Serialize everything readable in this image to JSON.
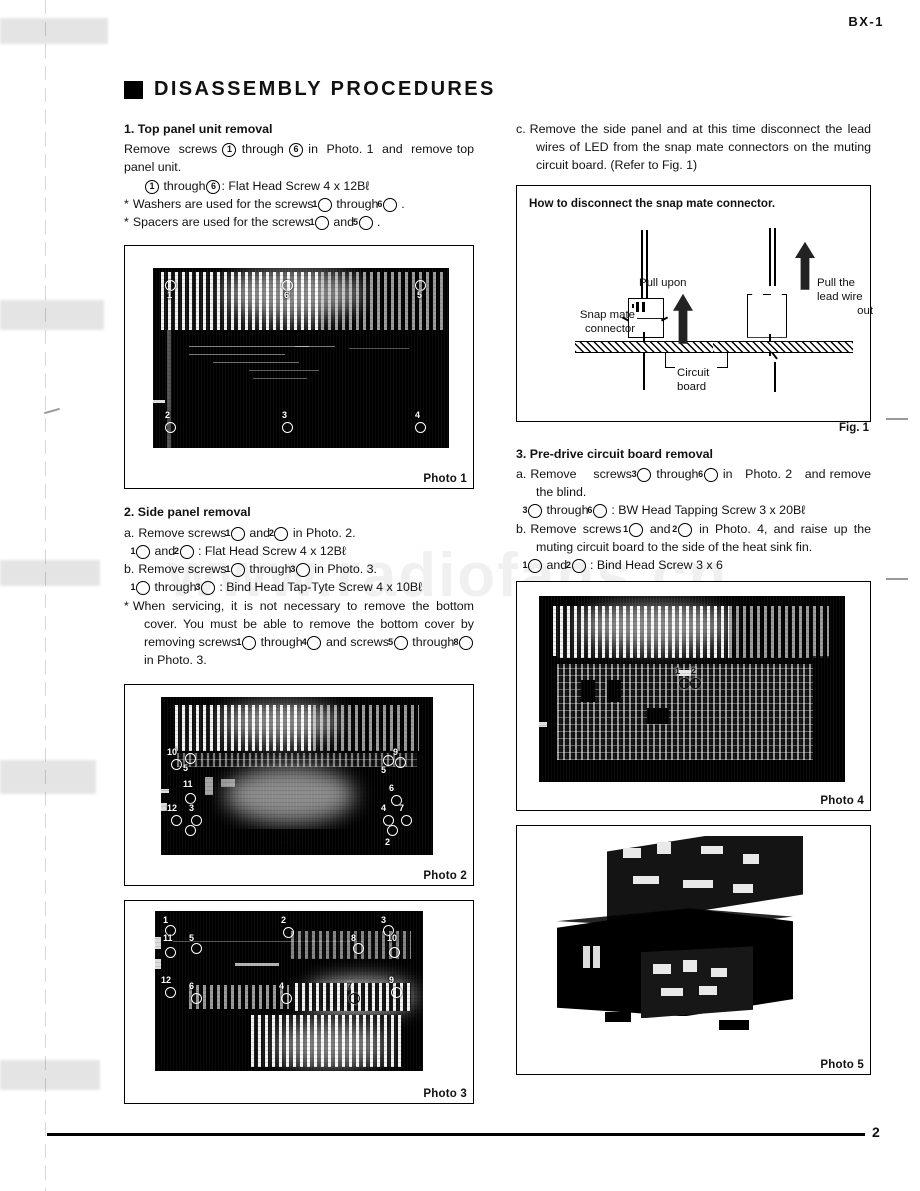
{
  "document": {
    "model_header": "BX-1",
    "page_number": "2",
    "watermark": "www.radiofans.cn",
    "title": "DISASSEMBLY PROCEDURES"
  },
  "left_column": {
    "section1": {
      "heading": "1. Top panel unit removal",
      "lines": [
        "Remove screws ① through ⑥ in Photo. 1 and remove top panel unit.",
        "① through⑥: Flat Head Screw 4 x 12Bℓ",
        "Washers are used for the screws ① through ⑥ .",
        "Spacers are used for the screws ① and ⑤ ."
      ]
    },
    "photo1": {
      "caption": "Photo 1"
    },
    "section2": {
      "heading": "2. Side panel removal",
      "items": [
        "a. Remove screws ① and ② in Photo. 2.",
        "① and ② : Flat Head Screw 4 x 12Bℓ",
        "b. Remove screws ① through ③ in Photo. 3.",
        "① through ③ : Bind Head Tap-Tyte Screw 4 x 10Bℓ",
        "When servicing, it is not necessary to remove the bottom cover. You must be able to remove the bottom cover by removing screws ① through ④ and screws ⑤ through ⑧ in Photo. 3."
      ]
    },
    "photo2": {
      "caption": "Photo 2"
    },
    "photo3": {
      "caption": "Photo 3"
    }
  },
  "right_column": {
    "item_c": "c. Remove the side panel and at this time disconnect the lead wires of LED from the snap mate connectors on the muting circuit board. (Refer to Fig. 1)",
    "figure1": {
      "title": "How to disconnect the snap mate connector.",
      "label_pull_upon": "Pull upon",
      "label_pull_lead_wire_out": "Pull the\nlead wire\nout",
      "label_snap_mate_connector": "Snap mate\nconnector",
      "label_circuit_board": "Circuit\nboard",
      "caption": "Fig. 1"
    },
    "section3": {
      "heading": "3. Pre-drive circuit board removal",
      "items": [
        "a. Remove screws ③ through ⑥ in Photo. 2 and remove the blind.",
        "③ through ⑥ : BW Head Tapping Screw 3 x 20Bℓ",
        "b. Remove screws ① and ② in Photo. 4, and raise up the muting circuit board to the side of the heat sink fin.",
        "① and ② : Bind Head Screw 3 x 6"
      ]
    },
    "photo4": {
      "caption": "Photo 4"
    },
    "photo5": {
      "caption": "Photo 5"
    }
  },
  "photo_callouts": {
    "photo1": [
      "1",
      "2",
      "3",
      "4",
      "5",
      "6"
    ],
    "photo2": [
      "1",
      "2",
      "3",
      "4",
      "5",
      "6",
      "7",
      "8",
      "9",
      "10",
      "11",
      "12"
    ],
    "photo3": [
      "1",
      "2",
      "3",
      "4",
      "5",
      "6",
      "7",
      "8",
      "9",
      "10",
      "11",
      "12"
    ],
    "photo4": [
      "1",
      "2"
    ]
  },
  "colors": {
    "ink": "#111111",
    "paper": "#ffffff",
    "watermark": "#000000"
  }
}
